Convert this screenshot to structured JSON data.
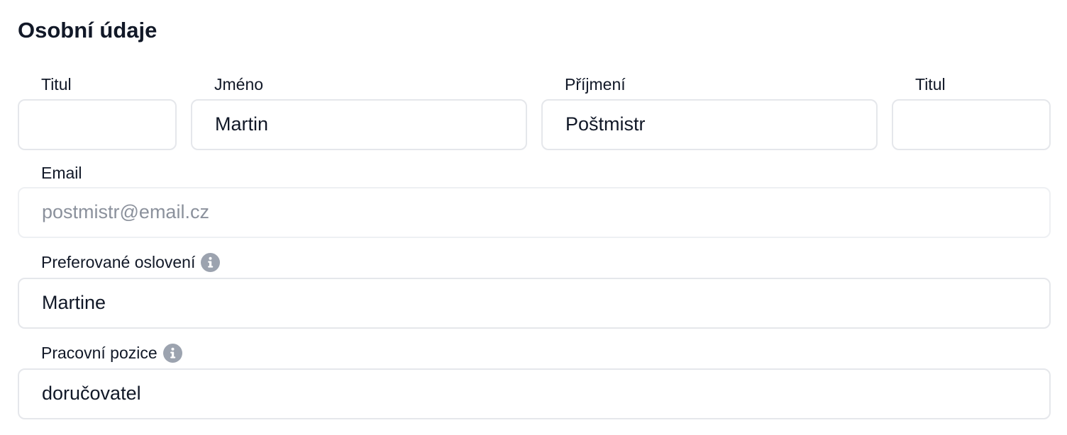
{
  "section": {
    "title": "Osobní údaje"
  },
  "fields": {
    "title_before": {
      "label": "Titul",
      "value": ""
    },
    "first_name": {
      "label": "Jméno",
      "value": "Martin"
    },
    "last_name": {
      "label": "Příjmení",
      "value": "Poštmistr"
    },
    "title_after": {
      "label": "Titul",
      "value": ""
    },
    "email": {
      "label": "Email",
      "value": "postmistr@email.cz",
      "state": "disabled"
    },
    "preferred_salutation": {
      "label": "Preferované oslovení",
      "value": "Martine",
      "info_icon": "info-icon"
    },
    "job_position": {
      "label": "Pracovní pozice",
      "value": "doručovatel",
      "info_icon": "info-icon"
    }
  },
  "colors": {
    "text": "#111827",
    "border": "#e5e7eb",
    "disabled_text": "#8b919c",
    "icon": "#9ca3af"
  }
}
